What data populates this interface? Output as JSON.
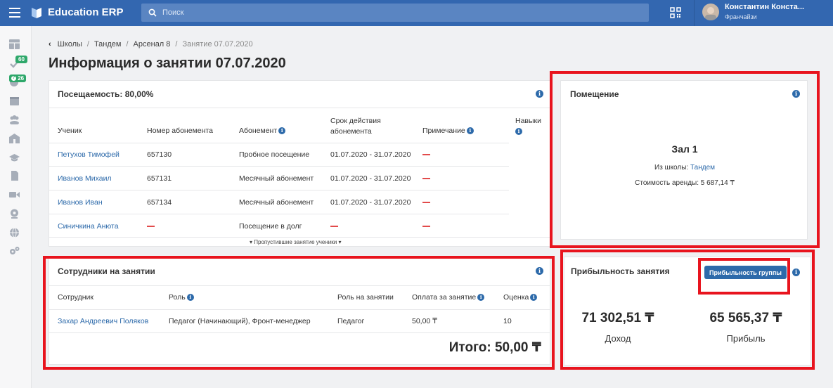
{
  "app": {
    "brand": "Education ERP"
  },
  "search": {
    "placeholder": "Поиск"
  },
  "user": {
    "name": "Константин Конста...",
    "role": "Франчайзи"
  },
  "sidebar": {
    "badges": [
      "60",
      "26"
    ]
  },
  "breadcrumb": [
    "Школы",
    "Тандем",
    "Арсенал 8",
    "Занятие 07.07.2020"
  ],
  "page_title": "Информация о занятии 07.07.2020",
  "attendance": {
    "title": "Посещаемость: 80,00%",
    "headers": {
      "student": "Ученик",
      "pass_number": "Номер абонемента",
      "pass": "Абонемент",
      "validity_line1": "Срок действия",
      "validity_line2": "абонемента",
      "note": "Примечание",
      "skills": "Навыки"
    },
    "rows": [
      {
        "student": "Петухов Тимофей",
        "pass_number": "657130",
        "pass": "Пробное посещение",
        "validity": "01.07.2020 - 31.07.2020"
      },
      {
        "student": "Иванов Михаил",
        "pass_number": "657131",
        "pass": "Месячный абонемент",
        "validity": "01.07.2020 - 31.07.2020"
      },
      {
        "student": "Иванов Иван",
        "pass_number": "657134",
        "pass": "Месячный абонемент",
        "validity": "01.07.2020 - 31.07.2020"
      },
      {
        "student": "Синичкина Анюта",
        "pass_number": "",
        "pass": "Посещение в долг",
        "validity": ""
      }
    ],
    "missed_toggle": "▾ Пропустившие занятие ученики ▾"
  },
  "room": {
    "title": "Помещение",
    "name": "Зал 1",
    "school_label": "Из школы:",
    "school_name": "Тандем",
    "rent_cost": "Стоимость аренды: 5 687,14 ₸"
  },
  "staff": {
    "title": "Сотрудники на занятии",
    "headers": {
      "employee": "Сотрудник",
      "role": "Роль",
      "lesson_role": "Роль на занятии",
      "payment": "Оплата за занятие",
      "rating": "Оценка"
    },
    "rows": [
      {
        "employee": "Захар Андреевич Поляков",
        "role": "Педагог (Начинающий), Фронт-менеджер",
        "lesson_role": "Педагог",
        "payment": "50,00 ₸",
        "rating": "10"
      }
    ],
    "total": "Итого: 50,00 ₸"
  },
  "profit": {
    "title": "Прибыльность занятия",
    "group_button": "Прибыльность группы",
    "income_value": "71 302,51 ₸",
    "income_label": "Доход",
    "profit_value": "65 565,37 ₸",
    "profit_label": "Прибыль"
  },
  "colors": {
    "topbar": "#3367b0",
    "accent": "#2d6aaa",
    "highlight_frame": "#e8141e",
    "dash": "#e24b4b"
  }
}
